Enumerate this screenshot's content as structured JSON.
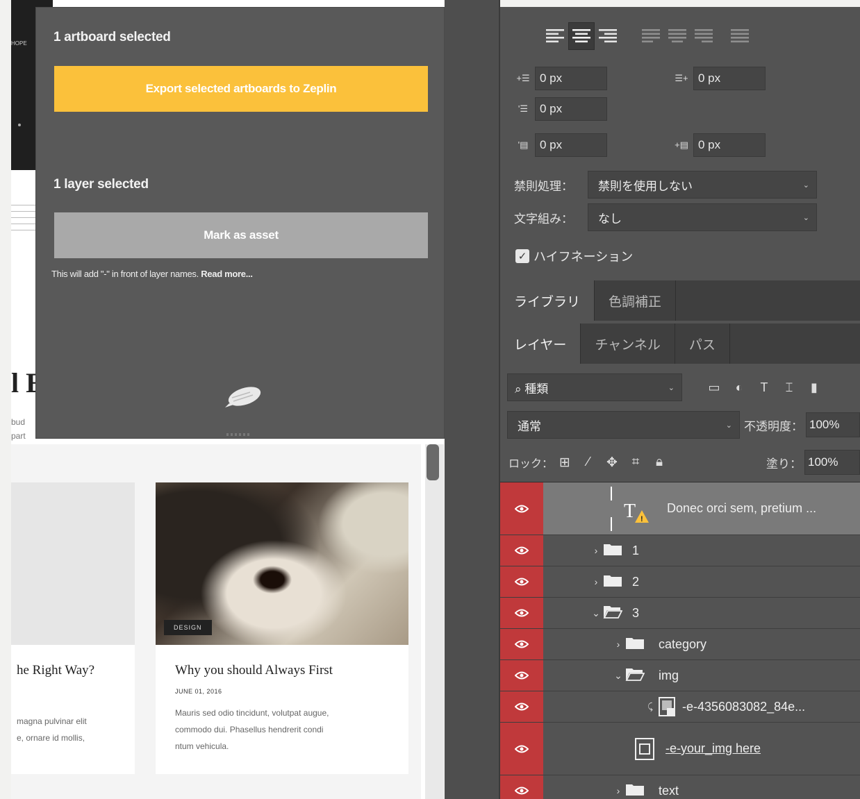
{
  "background": {
    "dark_labels": [
      "",
      "HOPE"
    ],
    "heading": "l E",
    "subtext": [
      "bud",
      "part"
    ],
    "cards": [
      {
        "title": "he Right Way?",
        "body": [
          "magna pulvinar elit",
          "e, ornare id mollis,"
        ]
      },
      {
        "badge": "DESIGN",
        "title": "Why you should Always First",
        "date": "JUNE 01, 2016",
        "body": [
          "Mauris sed odio tincidunt, volutpat augue,",
          "commodo dui. Phasellus hendrerit condi",
          "ntum vehicula."
        ]
      }
    ]
  },
  "zeplin": {
    "artboard_heading": "1 artboard selected",
    "export_label": "Export selected artboards to Zeplin",
    "layer_heading": "1 layer selected",
    "mark_label": "Mark as asset",
    "note_text": "This will add \"-\" in front of layer names. ",
    "note_link": "Read more...",
    "accent": "#fbc13b"
  },
  "photoshop": {
    "paragraph": {
      "indent_left": "0 px",
      "indent_right": "0 px",
      "indent_first": "0 px",
      "space_before": "0 px",
      "space_after": "0 px"
    },
    "kinsoku_label": "禁則処理：",
    "kinsoku_value": "禁則を使用しない",
    "mojikumi_label": "文字組み：",
    "mojikumi_value": "なし",
    "hyphenation_label": "ハイフネーション",
    "tabs_top": [
      "ライブラリ",
      "色調補正"
    ],
    "tabs_layers": [
      "レイヤー",
      "チャンネル",
      "パス"
    ],
    "kind_filter": "種類",
    "blend_mode": "通常",
    "opacity_label": "不透明度：",
    "opacity_value": "100%",
    "lock_label": "ロック：",
    "fill_label": "塗り：",
    "fill_value": "100%",
    "eye_color": "#c0393b",
    "layers": [
      {
        "name": "Donec orci sem, pretium ...",
        "type": "text",
        "selected": true
      },
      {
        "name": "1",
        "type": "folder"
      },
      {
        "name": "2",
        "type": "folder"
      },
      {
        "name": "3",
        "type": "folder-open"
      },
      {
        "name": "category",
        "type": "folder"
      },
      {
        "name": "img",
        "type": "folder-open"
      },
      {
        "name": "-e-4356083082_84e...",
        "type": "smart"
      },
      {
        "name": "-e-your_img here",
        "type": "shape"
      },
      {
        "name": "text",
        "type": "folder"
      }
    ]
  }
}
